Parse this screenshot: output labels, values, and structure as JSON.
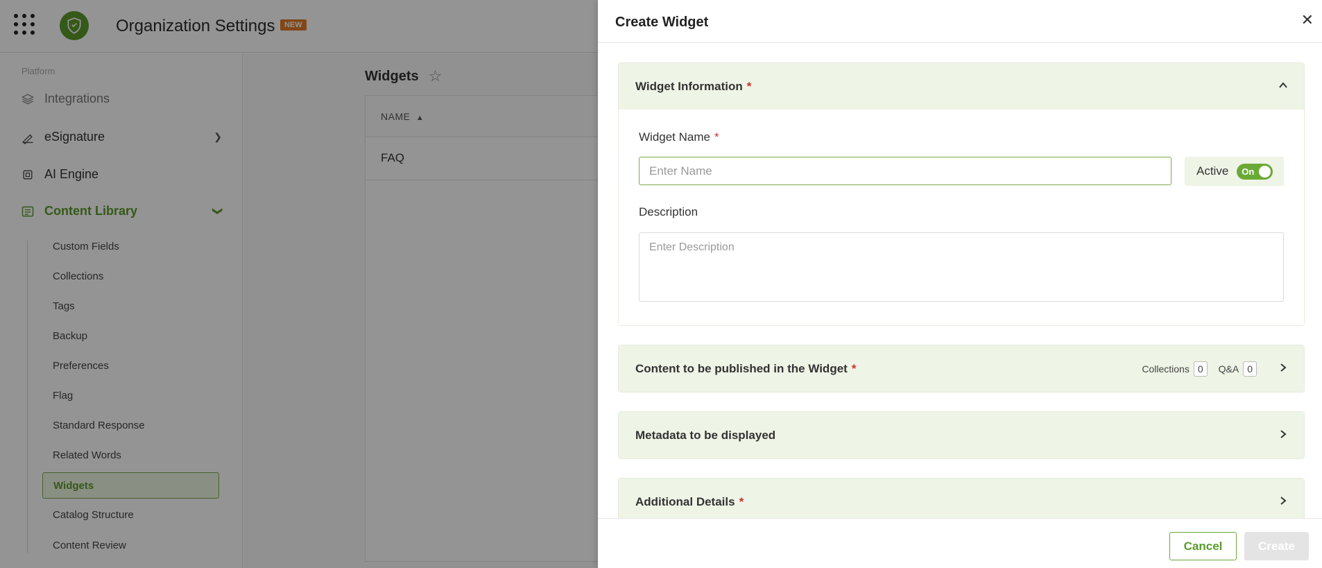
{
  "topbar": {
    "title": "Organization Settings",
    "badge": "NEW"
  },
  "sidebar": {
    "section_label": "Platform",
    "items": [
      {
        "label": "Integrations",
        "icon": "layers-icon"
      },
      {
        "label": "eSignature",
        "icon": "signature-icon"
      },
      {
        "label": "AI Engine",
        "icon": "chip-icon"
      },
      {
        "label": "Content Library",
        "icon": "library-icon"
      }
    ],
    "sub_items": [
      "Custom Fields",
      "Collections",
      "Tags",
      "Backup",
      "Preferences",
      "Flag",
      "Standard Response",
      "Related Words",
      "Widgets",
      "Catalog Structure",
      "Content Review"
    ],
    "selected_sub_item": "Widgets"
  },
  "main": {
    "title": "Widgets",
    "table": {
      "column_header": "NAME",
      "rows": [
        "FAQ"
      ]
    }
  },
  "drawer": {
    "title": "Create Widget",
    "widget_info": {
      "header": "Widget Information",
      "required_mark": "*",
      "name_label": "Widget Name",
      "name_placeholder": "Enter Name",
      "name_value": "",
      "active_label": "Active",
      "toggle_label": "On",
      "description_label": "Description",
      "description_placeholder": "Enter Description"
    },
    "content_section": {
      "header": "Content to be published in the Widget",
      "collections_label": "Collections",
      "collections_count": "0",
      "qa_label": "Q&A",
      "qa_count": "0"
    },
    "metadata_section": {
      "header": "Metadata to be displayed"
    },
    "additional_section": {
      "header": "Additional Details"
    },
    "footer": {
      "cancel_label": "Cancel",
      "create_label": "Create"
    }
  },
  "colors": {
    "accent": "#6aa936",
    "section_header_bg": "#eef4e6",
    "required": "#d0312d",
    "badge": "#e07a2a"
  }
}
